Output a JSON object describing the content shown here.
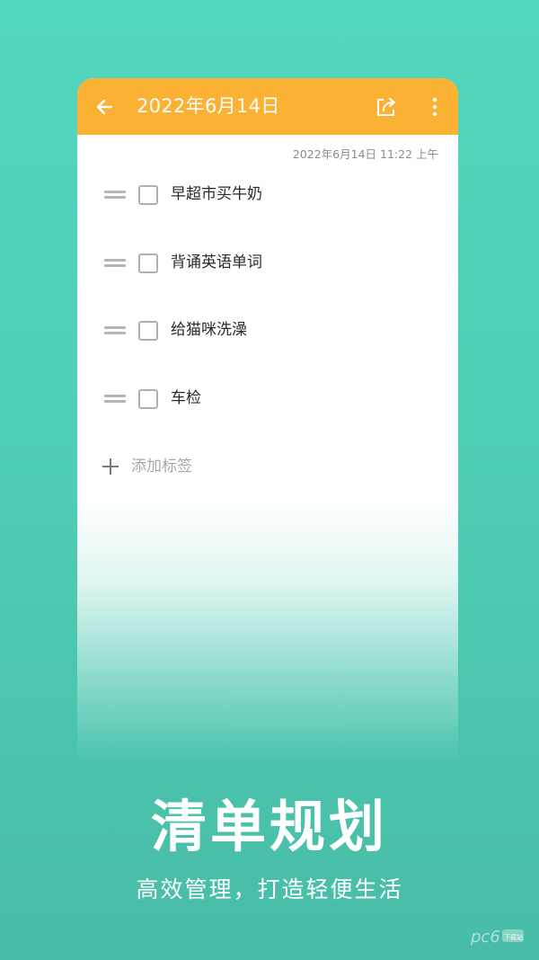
{
  "toolbar": {
    "title": "2022年6月14日",
    "background": "#fbb134",
    "back_icon": "arrow-left-icon",
    "share_icon": "share-icon",
    "more_icon": "more-vertical-icon"
  },
  "note": {
    "timestamp": "2022年6月14日 11:22 上午",
    "tasks": [
      {
        "label": "早超市买牛奶",
        "checked": false
      },
      {
        "label": "背诵英语单词",
        "checked": false
      },
      {
        "label": "给猫咪洗澡",
        "checked": false
      },
      {
        "label": "车检",
        "checked": false
      }
    ],
    "add_tag_label": "添加标签"
  },
  "promo": {
    "headline": "清单规划",
    "subline": "高效管理，打造轻便生活"
  },
  "watermark": {
    "text": "pc6",
    "sub": "下载站"
  },
  "colors": {
    "background": "#52d6bd",
    "accent": "#fbb134",
    "text": "#2a2a2a"
  }
}
